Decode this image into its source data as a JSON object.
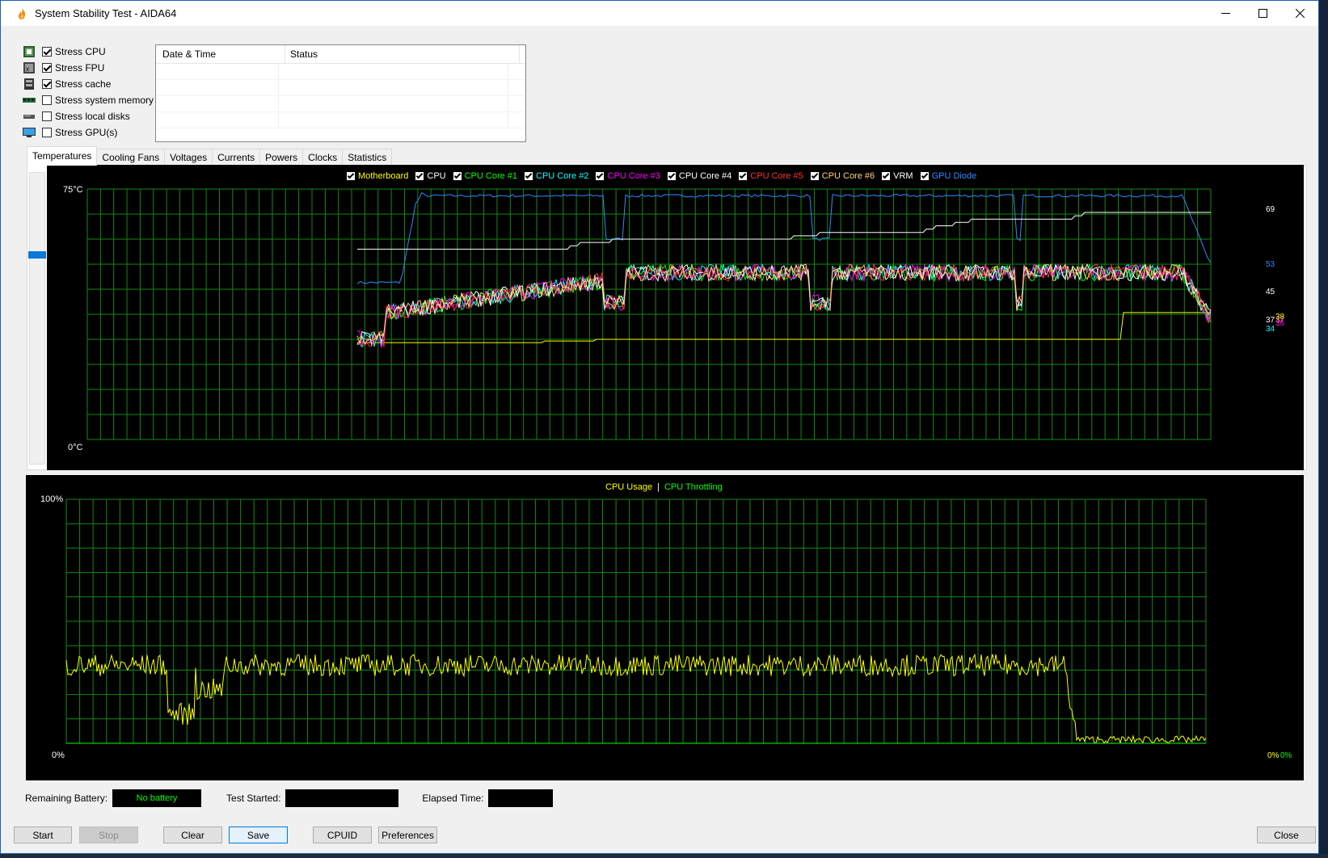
{
  "window": {
    "title": "System Stability Test - AIDA64"
  },
  "stress_options": [
    {
      "label": "Stress CPU",
      "checked": true,
      "icon": "cpu-chip-icon"
    },
    {
      "label": "Stress FPU",
      "checked": true,
      "icon": "fpu-chip-icon"
    },
    {
      "label": "Stress cache",
      "checked": true,
      "icon": "cache-icon"
    },
    {
      "label": "Stress system memory",
      "checked": false,
      "icon": "memory-module-icon"
    },
    {
      "label": "Stress local disks",
      "checked": false,
      "icon": "disk-drive-icon"
    },
    {
      "label": "Stress GPU(s)",
      "checked": false,
      "icon": "monitor-icon"
    }
  ],
  "log_table": {
    "columns": [
      "Date & Time",
      "Status"
    ]
  },
  "tabs": [
    "Temperatures",
    "Cooling Fans",
    "Voltages",
    "Currents",
    "Powers",
    "Clocks",
    "Statistics"
  ],
  "temp_chart": {
    "y_max_label": "75°C",
    "y_min_label": "0°C",
    "legend": [
      {
        "name": "Motherboard",
        "color": "#ffff00"
      },
      {
        "name": "CPU",
        "color": "#ffffff"
      },
      {
        "name": "CPU Core #1",
        "color": "#00ff00"
      },
      {
        "name": "CPU Core #2",
        "color": "#00ffff"
      },
      {
        "name": "CPU Core #3",
        "color": "#ff00ff"
      },
      {
        "name": "CPU Core #4",
        "color": "#ffffff"
      },
      {
        "name": "CPU Core #5",
        "color": "#ff3030"
      },
      {
        "name": "CPU Core #6",
        "color": "#ffd27f"
      },
      {
        "name": "VRM",
        "color": "#ffffff"
      },
      {
        "name": "GPU Diode",
        "color": "#2f8bff"
      }
    ],
    "end_values": [
      {
        "text": "69",
        "color": "#ffffff"
      },
      {
        "text": "53",
        "color": "#2f8bff"
      },
      {
        "text": "45",
        "color": "#ffffff"
      },
      {
        "text": "38",
        "color": "#ffff00"
      },
      {
        "text": "37",
        "color": "#ffffff"
      },
      {
        "text": "36",
        "color": "#ff00ff"
      },
      {
        "text": "37",
        "color": "#ff8080"
      },
      {
        "text": "34",
        "color": "#00ffff"
      }
    ]
  },
  "usage_chart": {
    "legend_usage": "CPU Usage",
    "legend_sep": "|",
    "legend_throttle": "CPU Throttling",
    "usage_color": "#ffff00",
    "throttle_color": "#00ff00",
    "y_max_label": "100%",
    "y_min_label": "0%",
    "end_usage": "0%",
    "end_throttle": "0%"
  },
  "status": {
    "battery_label": "Remaining Battery:",
    "battery_value": "No battery",
    "started_label": "Test Started:",
    "started_value": "",
    "elapsed_label": "Elapsed Time:",
    "elapsed_value": ""
  },
  "buttons": {
    "start": "Start",
    "stop": "Stop",
    "clear": "Clear",
    "save": "Save",
    "cpuid": "CPUID",
    "preferences": "Preferences",
    "close": "Close"
  }
}
